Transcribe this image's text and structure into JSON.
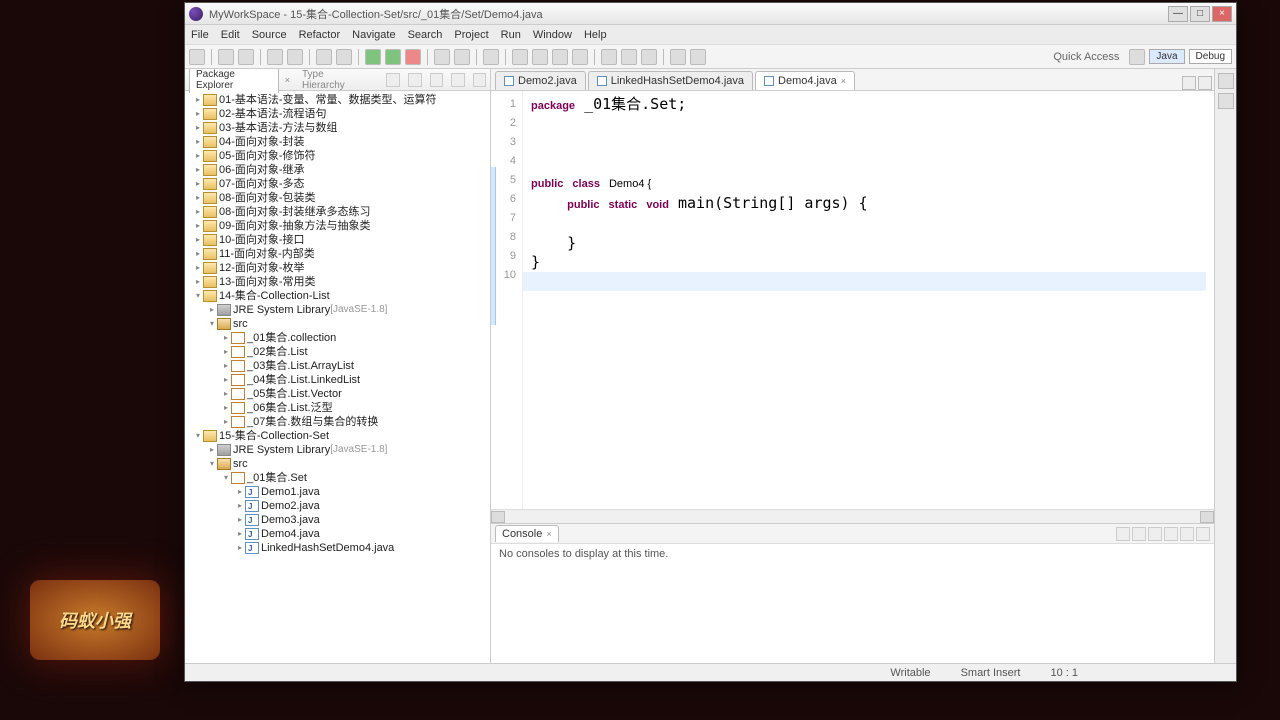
{
  "title": "MyWorkSpace - 15-集合-Collection-Set/src/_01集合/Set/Demo4.java",
  "window_controls": {
    "min": "—",
    "max": "□",
    "close": "×"
  },
  "menu": [
    "File",
    "Edit",
    "Source",
    "Refactor",
    "Navigate",
    "Search",
    "Project",
    "Run",
    "Window",
    "Help"
  ],
  "quick_access": "Quick Access",
  "perspectives": {
    "java": "Java",
    "debug": "Debug"
  },
  "left_views": {
    "active": "Package Explorer",
    "inactive": "Type Hierarchy"
  },
  "tree": [
    {
      "lvl": 1,
      "tw": "▸",
      "ico": "proj",
      "label": "01-基本语法-变量、常量、数据类型、运算符"
    },
    {
      "lvl": 1,
      "tw": "▸",
      "ico": "proj",
      "label": "02-基本语法-流程语句"
    },
    {
      "lvl": 1,
      "tw": "▸",
      "ico": "proj",
      "label": "03-基本语法-方法与数组"
    },
    {
      "lvl": 1,
      "tw": "▸",
      "ico": "proj",
      "label": "04-面向对象-封装"
    },
    {
      "lvl": 1,
      "tw": "▸",
      "ico": "proj",
      "label": "05-面向对象-修饰符"
    },
    {
      "lvl": 1,
      "tw": "▸",
      "ico": "proj",
      "label": "06-面向对象-继承"
    },
    {
      "lvl": 1,
      "tw": "▸",
      "ico": "proj",
      "label": "07-面向对象-多态"
    },
    {
      "lvl": 1,
      "tw": "▸",
      "ico": "proj",
      "label": "08-面向对象-包装类"
    },
    {
      "lvl": 1,
      "tw": "▸",
      "ico": "proj",
      "label": "08-面向对象-封装继承多态练习"
    },
    {
      "lvl": 1,
      "tw": "▸",
      "ico": "proj",
      "label": "09-面向对象-抽象方法与抽象类"
    },
    {
      "lvl": 1,
      "tw": "▸",
      "ico": "proj",
      "label": "10-面向对象-接口"
    },
    {
      "lvl": 1,
      "tw": "▸",
      "ico": "proj",
      "label": "11-面向对象-内部类"
    },
    {
      "lvl": 1,
      "tw": "▸",
      "ico": "proj",
      "label": "12-面向对象-枚举"
    },
    {
      "lvl": 1,
      "tw": "▸",
      "ico": "proj",
      "label": "13-面向对象-常用类"
    },
    {
      "lvl": 1,
      "tw": "▾",
      "ico": "proj",
      "label": "14-集合-Collection-List"
    },
    {
      "lvl": 2,
      "tw": "▸",
      "ico": "lib",
      "label": "JRE System Library",
      "extra": "[JavaSE-1.8]"
    },
    {
      "lvl": 2,
      "tw": "▾",
      "ico": "src",
      "label": "src"
    },
    {
      "lvl": 3,
      "tw": "▸",
      "ico": "pkg",
      "label": "_01集合.collection"
    },
    {
      "lvl": 3,
      "tw": "▸",
      "ico": "pkg",
      "label": "_02集合.List"
    },
    {
      "lvl": 3,
      "tw": "▸",
      "ico": "pkg",
      "label": "_03集合.List.ArrayList"
    },
    {
      "lvl": 3,
      "tw": "▸",
      "ico": "pkg",
      "label": "_04集合.List.LinkedList"
    },
    {
      "lvl": 3,
      "tw": "▸",
      "ico": "pkg",
      "label": "_05集合.List.Vector"
    },
    {
      "lvl": 3,
      "tw": "▸",
      "ico": "pkg",
      "label": "_06集合.List.泛型"
    },
    {
      "lvl": 3,
      "tw": "▸",
      "ico": "pkg",
      "label": "_07集合.数组与集合的转换"
    },
    {
      "lvl": 1,
      "tw": "▾",
      "ico": "proj",
      "label": "15-集合-Collection-Set"
    },
    {
      "lvl": 2,
      "tw": "▸",
      "ico": "lib",
      "label": "JRE System Library",
      "extra": "[JavaSE-1.8]"
    },
    {
      "lvl": 2,
      "tw": "▾",
      "ico": "src",
      "label": "src"
    },
    {
      "lvl": 3,
      "tw": "▾",
      "ico": "pkg",
      "label": "_01集合.Set"
    },
    {
      "lvl": 4,
      "tw": "▸",
      "ico": "java",
      "label": "Demo1.java"
    },
    {
      "lvl": 4,
      "tw": "▸",
      "ico": "java",
      "label": "Demo2.java"
    },
    {
      "lvl": 4,
      "tw": "▸",
      "ico": "java",
      "label": "Demo3.java"
    },
    {
      "lvl": 4,
      "tw": "▸",
      "ico": "java",
      "label": "Demo4.java"
    },
    {
      "lvl": 4,
      "tw": "▸",
      "ico": "java",
      "label": "LinkedHashSetDemo4.java"
    }
  ],
  "editor_tabs": [
    {
      "label": "Demo2.java",
      "active": false
    },
    {
      "label": "LinkedHashSetDemo4.java",
      "active": false
    },
    {
      "label": "Demo4.java",
      "active": true
    }
  ],
  "code_lines": {
    "1": "package _01集合.Set;",
    "5_pre": "public class ",
    "5_typ": "Demo4",
    "5_post": " {",
    "6": "    public static void main(String[] args) {",
    "8": "    }",
    "9": "}"
  },
  "console": {
    "tab": "Console",
    "message": "No consoles to display at this time."
  },
  "status": {
    "writable": "Writable",
    "insert": "Smart Insert",
    "pos": "10 : 1"
  },
  "logo": "码蚁小强"
}
